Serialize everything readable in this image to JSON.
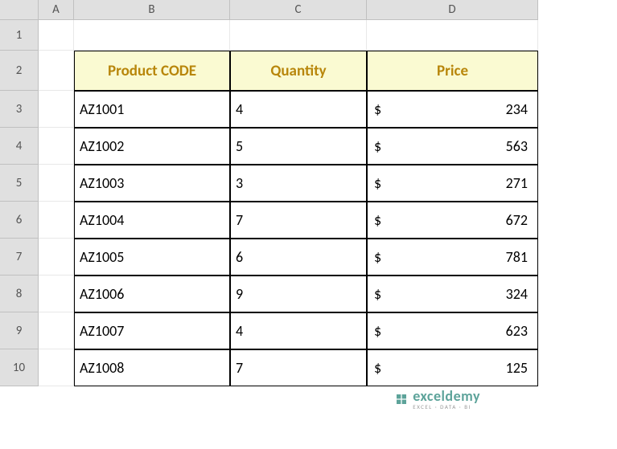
{
  "columns": [
    "A",
    "B",
    "C",
    "D"
  ],
  "rows": [
    "1",
    "2",
    "3",
    "4",
    "5",
    "6",
    "7",
    "8",
    "9",
    "10"
  ],
  "table": {
    "headers": {
      "code": "Product CODE",
      "quantity": "Quantity",
      "price": "Price"
    },
    "currency": "$",
    "data": [
      {
        "code": "AZ1001",
        "quantity": "4",
        "price": "234"
      },
      {
        "code": "AZ1002",
        "quantity": "5",
        "price": "563"
      },
      {
        "code": "AZ1003",
        "quantity": "3",
        "price": "271"
      },
      {
        "code": "AZ1004",
        "quantity": "7",
        "price": "672"
      },
      {
        "code": "AZ1005",
        "quantity": "6",
        "price": "781"
      },
      {
        "code": "AZ1006",
        "quantity": "9",
        "price": "324"
      },
      {
        "code": "AZ1007",
        "quantity": "4",
        "price": "623"
      },
      {
        "code": "AZ1008",
        "quantity": "7",
        "price": "125"
      }
    ]
  },
  "branding": {
    "name": "exceldemy",
    "tagline": "EXCEL · DATA · BI"
  }
}
